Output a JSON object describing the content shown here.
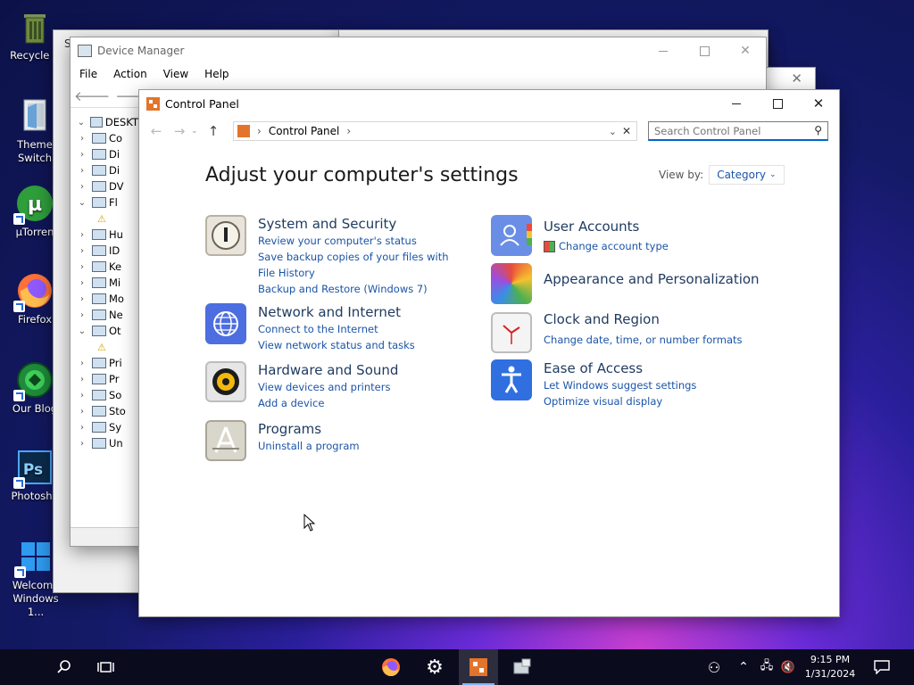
{
  "desktop": {
    "icons": [
      {
        "label": "Recycle B"
      },
      {
        "label": "Theme Switch"
      },
      {
        "label": "µTorren"
      },
      {
        "label": "Firefox"
      },
      {
        "label": "Our Blog"
      },
      {
        "label": "Photosho"
      },
      {
        "label": "Welcome Windows 1..."
      }
    ]
  },
  "bg_window": {
    "title_fragment": "S"
  },
  "device_manager": {
    "title": "Device Manager",
    "menu": [
      "File",
      "Action",
      "View",
      "Help"
    ],
    "tree_root": "DESKT",
    "tree_items": [
      "Co",
      "Di",
      "Di",
      "DV",
      "Fl",
      "",
      "Hu",
      "ID",
      "Ke",
      "Mi",
      "Mo",
      "Ne",
      "Ot",
      "",
      "Pri",
      "Pr",
      "So",
      "Sto",
      "Sy",
      "Un"
    ]
  },
  "control_panel": {
    "title": "Control Panel",
    "address": "Control Panel",
    "search_placeholder": "Search Control Panel",
    "heading": "Adjust your computer's settings",
    "view_by_label": "View by:",
    "view_by_value": "Category",
    "categories": [
      {
        "title": "System and Security",
        "links": [
          "Review your computer's status",
          "Save backup copies of your files with File History",
          "Backup and Restore (Windows 7)"
        ]
      },
      {
        "title": "Network and Internet",
        "links": [
          "Connect to the Internet",
          "View network status and tasks"
        ]
      },
      {
        "title": "Hardware and Sound",
        "links": [
          "View devices and printers",
          "Add a device"
        ]
      },
      {
        "title": "Programs",
        "links": [
          "Uninstall a program"
        ]
      },
      {
        "title": "User Accounts",
        "links": [
          "Change account type"
        ]
      },
      {
        "title": "Appearance and Personalization",
        "links": []
      },
      {
        "title": "Clock and Region",
        "links": [
          "Change date, time, or number formats"
        ]
      },
      {
        "title": "Ease of Access",
        "links": [
          "Let Windows suggest settings",
          "Optimize visual display"
        ]
      }
    ]
  },
  "taskbar": {
    "time": "9:15 PM",
    "date": "1/31/2024"
  }
}
